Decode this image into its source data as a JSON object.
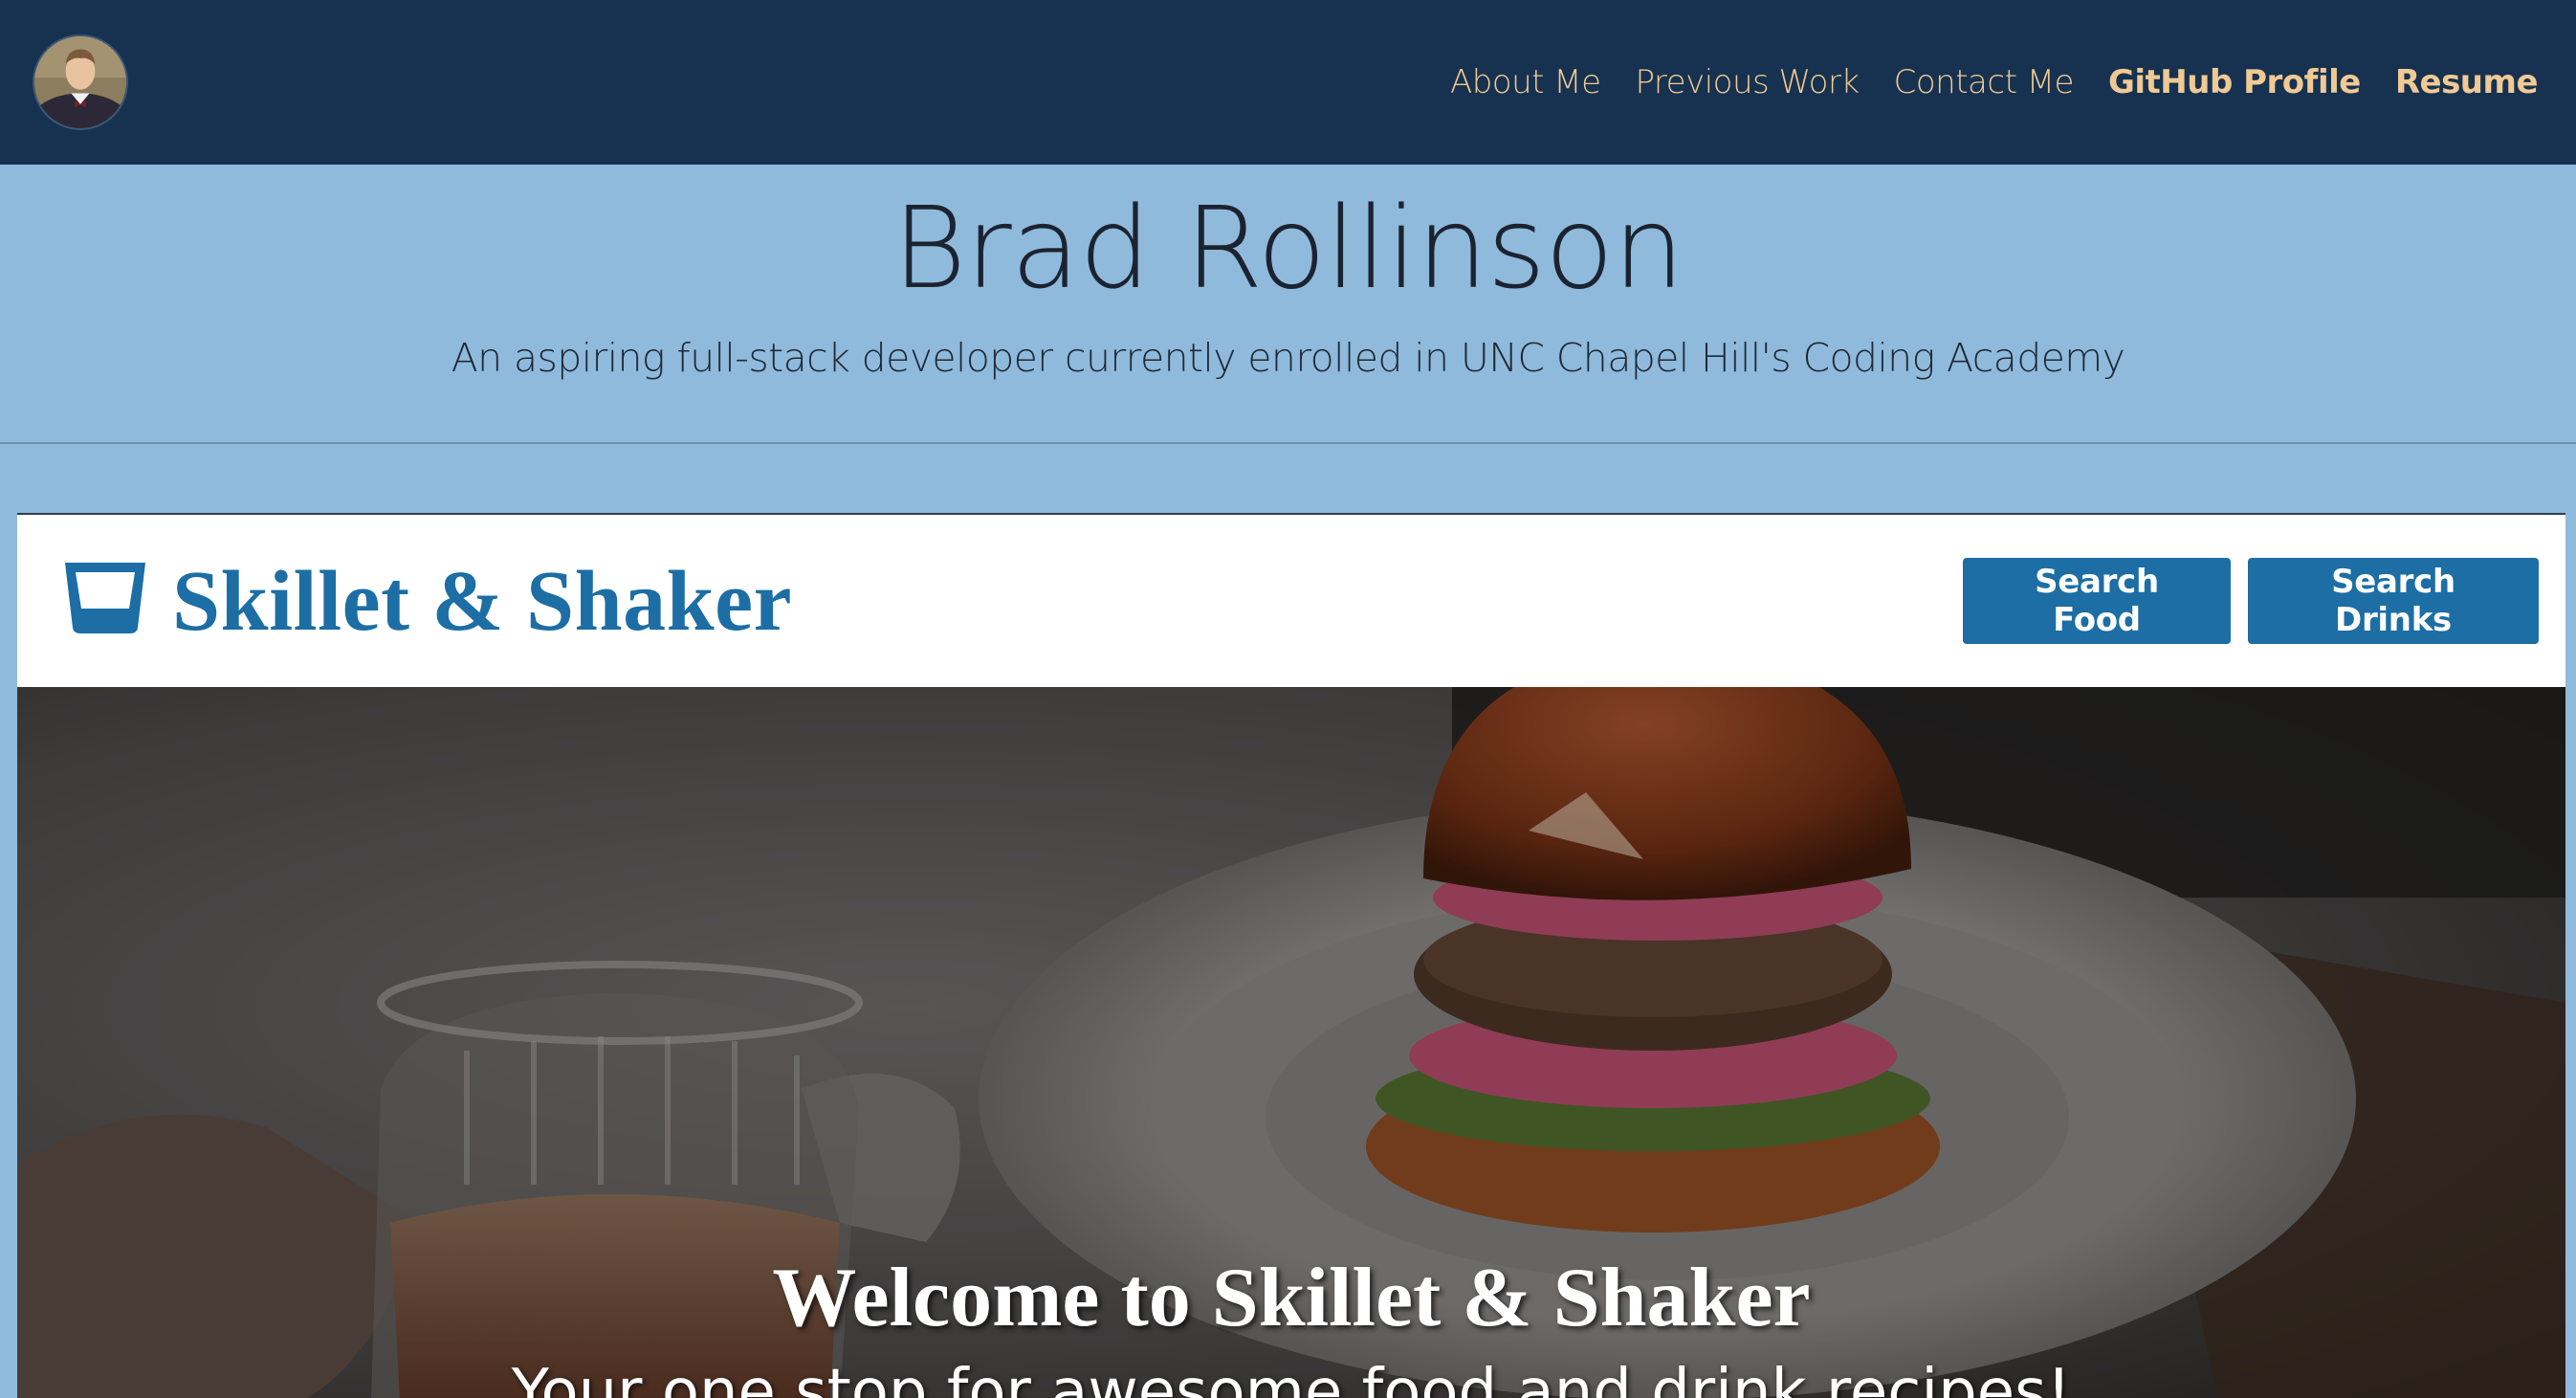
{
  "nav": {
    "avatar_icon": "profile-photo",
    "links": [
      {
        "label": "About Me",
        "bold": false
      },
      {
        "label": "Previous Work",
        "bold": false
      },
      {
        "label": "Contact Me",
        "bold": false
      },
      {
        "label": "GitHub Profile",
        "bold": true
      },
      {
        "label": "Resume",
        "bold": true
      }
    ]
  },
  "header": {
    "name": "Brad Rollinson",
    "subtitle": "An aspiring full-stack developer currently enrolled in UNC Chapel Hill's Coding Academy"
  },
  "preview": {
    "brand_icon": "glass-icon",
    "title": "Skillet & Shaker",
    "buttons": {
      "food": "Search Food",
      "drinks": "Search Drinks"
    },
    "hero": {
      "title": "Welcome to Skillet & Shaker",
      "subtitle": "Your one stop for awesome food and drink recipes!"
    }
  },
  "colors": {
    "nav_bg": "#163250",
    "nav_link": "#f0c994",
    "page_bg": "#8fbadb",
    "brand_blue": "#1c6ea4",
    "button_text": "#ffffff"
  }
}
